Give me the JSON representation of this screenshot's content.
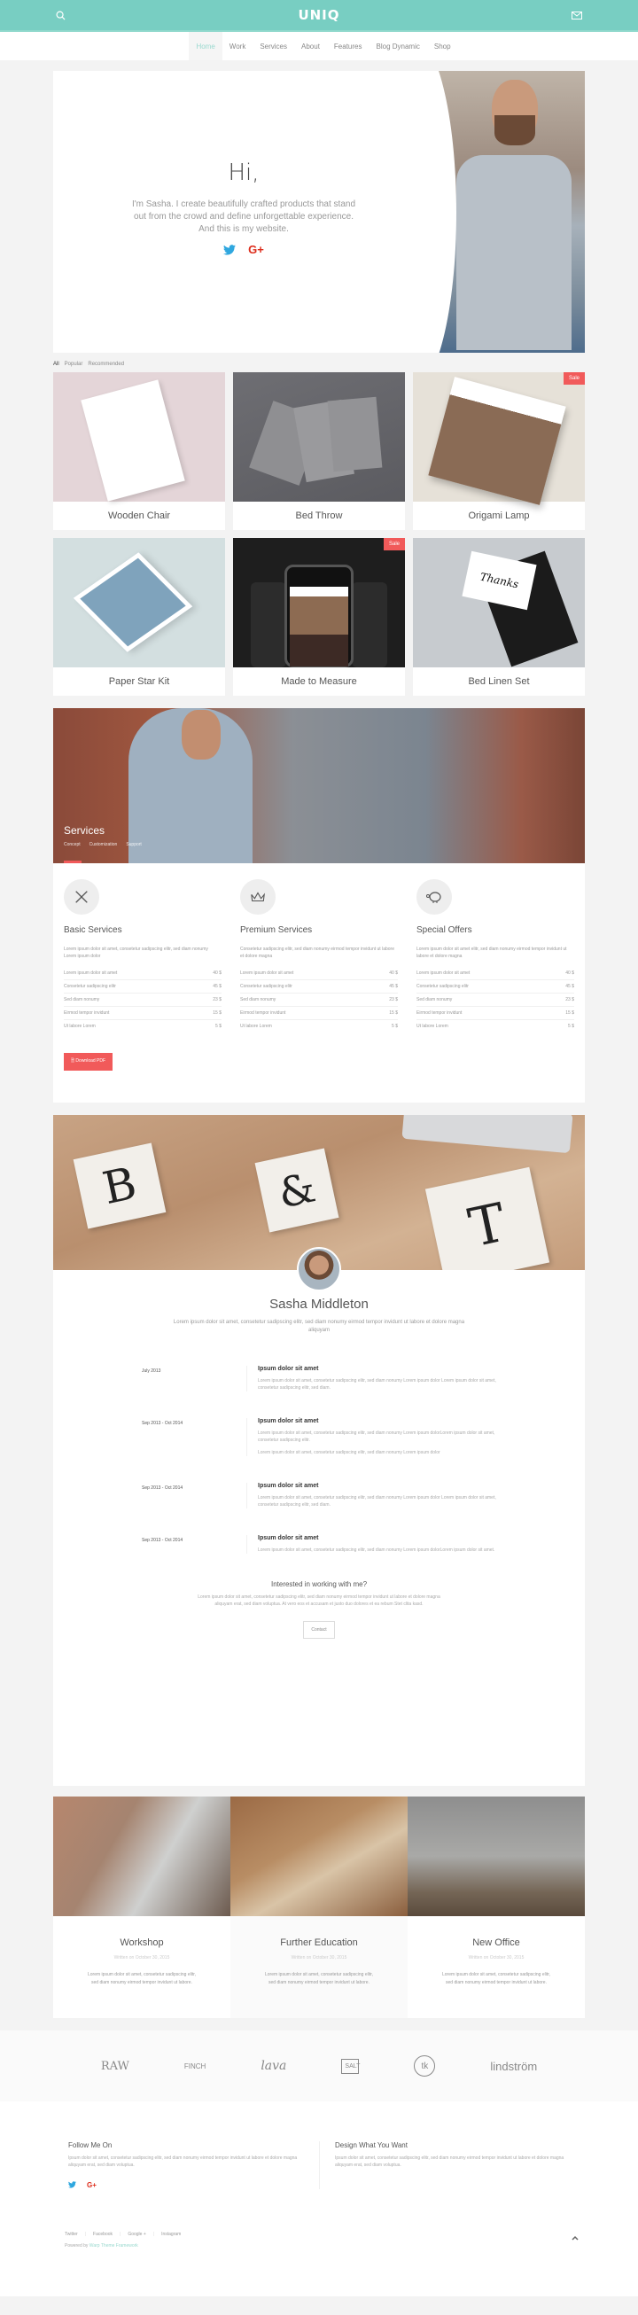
{
  "header": {
    "logo": "UNIQ",
    "search_icon": "search-icon",
    "mail_icon": "mail-icon",
    "accent_color": "#78cec2"
  },
  "nav": {
    "items": [
      {
        "label": "Home",
        "active": true
      },
      {
        "label": "Work"
      },
      {
        "label": "Services"
      },
      {
        "label": "About"
      },
      {
        "label": "Features"
      },
      {
        "label": "Blog Dynamic"
      },
      {
        "label": "Shop"
      }
    ]
  },
  "hero": {
    "title": "Hi,",
    "text": "I'm Sasha. I create beautifully crafted products that stand out from the crowd and define unforgettable experience. And this is my website.",
    "social": [
      "twitter-icon",
      "google-plus-icon"
    ]
  },
  "portfolio": {
    "filters": [
      "All",
      "Popular",
      "Recommended"
    ],
    "items": [
      {
        "title": "Wooden Chair",
        "badge": null
      },
      {
        "title": "Bed Throw",
        "badge": null
      },
      {
        "title": "Origami Lamp",
        "badge": "Sale"
      },
      {
        "title": "Paper Star Kit",
        "badge": null
      },
      {
        "title": "Made to Measure",
        "badge": "Sale"
      },
      {
        "title": "Bed Linen Set",
        "badge": null
      }
    ]
  },
  "services_banner": {
    "title": "Services",
    "links": [
      "Concept",
      "Customization",
      "Support"
    ]
  },
  "services": {
    "columns": [
      {
        "icon": "pencil-ruler-icon",
        "title": "Basic Services",
        "desc": "Lorem ipsum dolor sit amet, consetetur sadipscing elitr, sed diam nonumy Lorem ipsum dolor",
        "rows": [
          {
            "label": "Lorem ipsum dolor sit amet",
            "price": "40 $"
          },
          {
            "label": "Consetetur sadipscing elitr",
            "price": "45 $"
          },
          {
            "label": "Sed diam nonumy",
            "price": "23 $"
          },
          {
            "label": "Eirmod tempor invidunt",
            "price": "15 $"
          },
          {
            "label": "Ut labore Lorem",
            "price": "5 $"
          }
        ]
      },
      {
        "icon": "crown-icon",
        "title": "Premium Services",
        "desc": "Consetetur sadipscing elitr, sed diam nonumy eirmod tempor invidunt ut labore et dolore magna",
        "rows": [
          {
            "label": "Lorem ipsum dolor sit amet",
            "price": "40 $"
          },
          {
            "label": "Consetetur sadipscing elitr",
            "price": "45 $"
          },
          {
            "label": "Sed diam nonumy",
            "price": "23 $"
          },
          {
            "label": "Eirmod tempor invidunt",
            "price": "15 $"
          },
          {
            "label": "Ut labore Lorem",
            "price": "5 $"
          }
        ]
      },
      {
        "icon": "piggy-bank-icon",
        "title": "Special Offers",
        "desc": "Lorem ipsum dolor sit amet elitr, sed diam nonumy eirmod tempor invidunt ut labore et dolore magna",
        "rows": [
          {
            "label": "Lorem ipsum dolor sit amet",
            "price": "40 $"
          },
          {
            "label": "Consetetur sadipscing elitr",
            "price": "45 $"
          },
          {
            "label": "Sed diam nonumy",
            "price": "23 $"
          },
          {
            "label": "Eirmod tempor invidunt",
            "price": "15 $"
          },
          {
            "label": "Ut labore Lorem",
            "price": "5 $"
          }
        ]
      }
    ],
    "download_label": "Download PDF"
  },
  "about": {
    "name": "Sasha Middleton",
    "lead": "Lorem ipsum dolor sit amet, consetetur sadipscing elitr, sed diam nonumy eirmod tempor invidunt ut labore et dolore magna aliquyam",
    "timeline": [
      {
        "date": "July 2013",
        "title": "Ipsum dolor sit amet",
        "paras": [
          "Lorem ipsum dolor sit amet, consetetur sadipscing elitr, sed diam nonumy Lorem ipsum dolor Lorem ipsum dolor sit amet, consetetur sadipscing elitr, sed diam."
        ]
      },
      {
        "date": "Sep 2013 - Oct 2014",
        "title": "Ipsum dolor sit amet",
        "paras": [
          "Lorem ipsum dolor sit amet, consetetur sadipscing elitr, sed diam nonumy Lorem ipsum dolorLorem ipsum dolor sit amet, consetetur sadipscing elitr.",
          "Lorem ipsum dolor sit amet, consetetur sadipscing elitr, sed diam nonumy Lorem ipsum dolor"
        ]
      },
      {
        "date": "Sep 2013 - Oct 2014",
        "title": "Ipsum dolor sit amet",
        "paras": [
          "Lorem ipsum dolor sit amet, consetetur sadipscing elitr, sed diam nonumy Lorem ipsum dolor Lorem ipsum dolor sit amet, consetetur sadipscing elitr, sed diam."
        ]
      },
      {
        "date": "Sep 2013 - Oct 2014",
        "title": "Ipsum dolor sit amet",
        "paras": [
          "Lorem ipsum dolor sit amet, consetetur sadipscing elitr, sed diam nonumy Lorem ipsum dolorLorem ipsum dolor sit amet."
        ]
      }
    ],
    "cta": {
      "title": "Interested in working with me?",
      "text": "Lorem ipsum dolor sit amet, consetetur sadipscing elitr, sed diam nonumy eirmod tempor invidunt ut labore et dolore magna aliquyam erat, sed diam voluptua. At vero eos et accusam et justo duo dolores et ea rebum Stet clita kasd.",
      "button": "Contact"
    }
  },
  "blog": {
    "posts": [
      {
        "title": "Workshop",
        "meta": "Written on October 30, 2015",
        "excerpt": "Lorem ipsum dolor sit amet, consetetur sadipscing elitr, sed diam nonumy eirmod tempor invidunt ut labore."
      },
      {
        "title": "Further Education",
        "meta": "Written on October 30, 2015",
        "excerpt": "Lorem ipsum dolor sit amet, consetetur sadipscing elitr, sed diam nonumy eirmod tempor invidunt ut labore."
      },
      {
        "title": "New Office",
        "meta": "Written on October 30, 2015",
        "excerpt": "Lorem ipsum dolor sit amet, consetetur sadipscing elitr, sed diam nonumy eirmod tempor invidunt ut labore."
      }
    ]
  },
  "brands": [
    "RAW",
    "FINCH",
    "lava",
    "SALT",
    "tk",
    "lindström"
  ],
  "footer": {
    "col1": {
      "title": "Follow Me On",
      "text": "Ipsum dolor sit amet, consetetur sadipscing elitr, sed diam nonumy eirmod tempor invidunt ut labore et dolore magna aliquyam erat, sed diam voluptua."
    },
    "col2": {
      "title": "Design What You Want",
      "text": "Ipsum dolor sit amet, consetetur sadipscing elitr, sed diam nonumy eirmod tempor invidunt ut labore et dolore magna aliquyam erat, sed diam voluptua."
    },
    "links": [
      "Twitter",
      "Facebook",
      "Google +",
      "Instagram"
    ],
    "powered_prefix": "Powered by",
    "powered_link": "Warp Theme Framework"
  }
}
